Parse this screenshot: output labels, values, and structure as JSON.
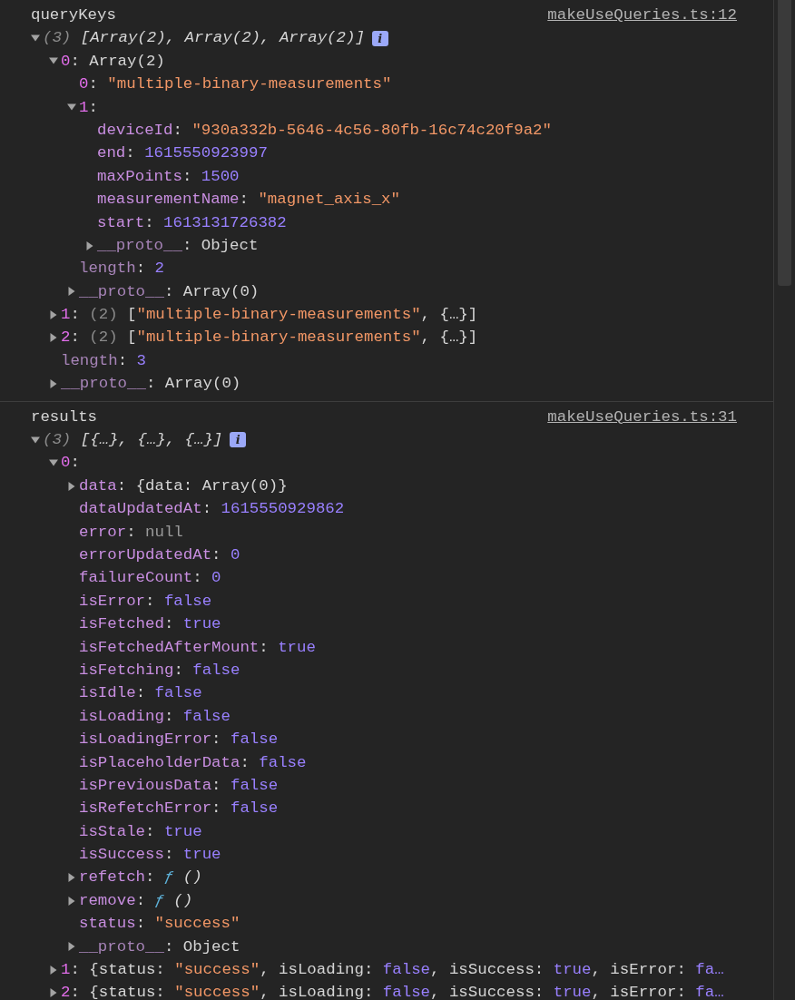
{
  "messages": [
    {
      "label": "queryKeys",
      "source_link": "makeUseQueries.ts:12",
      "tree": [
        {
          "expanded": true,
          "tokens": [
            {
              "kind": "summary_count",
              "text": "(3) "
            },
            {
              "kind": "summary",
              "text": "[Array(2), Array(2), Array(2)]"
            },
            {
              "kind": "info",
              "text": "i"
            }
          ],
          "children": [
            {
              "expanded": true,
              "tokens": [
                {
                  "kind": "index",
                  "text": "0"
                },
                {
                  "kind": "punct",
                  "text": ": "
                },
                {
                  "kind": "plain",
                  "text": "Array(2)"
                }
              ],
              "children": [
                {
                  "tokens": [
                    {
                      "kind": "index",
                      "text": "0"
                    },
                    {
                      "kind": "punct",
                      "text": ": "
                    },
                    {
                      "kind": "string",
                      "text": "\"multiple-binary-measurements\""
                    }
                  ]
                },
                {
                  "expanded": true,
                  "tokens": [
                    {
                      "kind": "index",
                      "text": "1"
                    },
                    {
                      "kind": "punct",
                      "text": ":"
                    }
                  ],
                  "children": [
                    {
                      "tokens": [
                        {
                          "kind": "key",
                          "text": "deviceId"
                        },
                        {
                          "kind": "punct",
                          "text": ": "
                        },
                        {
                          "kind": "string",
                          "text": "\"930a332b-5646-4c56-80fb-16c74c20f9a2\""
                        }
                      ]
                    },
                    {
                      "tokens": [
                        {
                          "kind": "key",
                          "text": "end"
                        },
                        {
                          "kind": "punct",
                          "text": ": "
                        },
                        {
                          "kind": "number",
                          "text": "1615550923997"
                        }
                      ]
                    },
                    {
                      "tokens": [
                        {
                          "kind": "key",
                          "text": "maxPoints"
                        },
                        {
                          "kind": "punct",
                          "text": ": "
                        },
                        {
                          "kind": "number",
                          "text": "1500"
                        }
                      ]
                    },
                    {
                      "tokens": [
                        {
                          "kind": "key",
                          "text": "measurementName"
                        },
                        {
                          "kind": "punct",
                          "text": ": "
                        },
                        {
                          "kind": "string",
                          "text": "\"magnet_axis_x\""
                        }
                      ]
                    },
                    {
                      "tokens": [
                        {
                          "kind": "key",
                          "text": "start"
                        },
                        {
                          "kind": "punct",
                          "text": ": "
                        },
                        {
                          "kind": "number",
                          "text": "1613131726382"
                        }
                      ]
                    },
                    {
                      "expanded": false,
                      "tokens": [
                        {
                          "kind": "dimkey",
                          "text": "__proto__"
                        },
                        {
                          "kind": "punct",
                          "text": ": "
                        },
                        {
                          "kind": "plain",
                          "text": "Object"
                        }
                      ]
                    }
                  ]
                },
                {
                  "tokens": [
                    {
                      "kind": "dimkey",
                      "text": "length"
                    },
                    {
                      "kind": "punct",
                      "text": ": "
                    },
                    {
                      "kind": "number",
                      "text": "2"
                    }
                  ]
                },
                {
                  "expanded": false,
                  "tokens": [
                    {
                      "kind": "dimkey",
                      "text": "__proto__"
                    },
                    {
                      "kind": "punct",
                      "text": ": "
                    },
                    {
                      "kind": "plain",
                      "text": "Array(0)"
                    }
                  ]
                }
              ]
            },
            {
              "expanded": false,
              "tokens": [
                {
                  "kind": "index",
                  "text": "1"
                },
                {
                  "kind": "punct",
                  "text": ": "
                },
                {
                  "kind": "count",
                  "text": "(2) "
                },
                {
                  "kind": "plain",
                  "text": "["
                },
                {
                  "kind": "string",
                  "text": "\"multiple-binary-measurements\""
                },
                {
                  "kind": "plain",
                  "text": ", {…}]"
                }
              ]
            },
            {
              "expanded": false,
              "tokens": [
                {
                  "kind": "index",
                  "text": "2"
                },
                {
                  "kind": "punct",
                  "text": ": "
                },
                {
                  "kind": "count",
                  "text": "(2) "
                },
                {
                  "kind": "plain",
                  "text": "["
                },
                {
                  "kind": "string",
                  "text": "\"multiple-binary-measurements\""
                },
                {
                  "kind": "plain",
                  "text": ", {…}]"
                }
              ]
            },
            {
              "tokens": [
                {
                  "kind": "dimkey",
                  "text": "length"
                },
                {
                  "kind": "punct",
                  "text": ": "
                },
                {
                  "kind": "number",
                  "text": "3"
                }
              ]
            },
            {
              "expanded": false,
              "tokens": [
                {
                  "kind": "dimkey",
                  "text": "__proto__"
                },
                {
                  "kind": "punct",
                  "text": ": "
                },
                {
                  "kind": "plain",
                  "text": "Array(0)"
                }
              ]
            }
          ]
        }
      ]
    },
    {
      "label": "results",
      "source_link": "makeUseQueries.ts:31",
      "tree": [
        {
          "expanded": true,
          "tokens": [
            {
              "kind": "summary_count",
              "text": "(3) "
            },
            {
              "kind": "summary",
              "text": "[{…}, {…}, {…}]"
            },
            {
              "kind": "info",
              "text": "i"
            }
          ],
          "children": [
            {
              "expanded": true,
              "tokens": [
                {
                  "kind": "index",
                  "text": "0"
                },
                {
                  "kind": "punct",
                  "text": ":"
                }
              ],
              "children": [
                {
                  "expanded": false,
                  "tokens": [
                    {
                      "kind": "key",
                      "text": "data"
                    },
                    {
                      "kind": "punct",
                      "text": ": "
                    },
                    {
                      "kind": "plain",
                      "text": "{data: Array(0)}"
                    }
                  ]
                },
                {
                  "tokens": [
                    {
                      "kind": "key",
                      "text": "dataUpdatedAt"
                    },
                    {
                      "kind": "punct",
                      "text": ": "
                    },
                    {
                      "kind": "number",
                      "text": "1615550929862"
                    }
                  ]
                },
                {
                  "tokens": [
                    {
                      "kind": "key",
                      "text": "error"
                    },
                    {
                      "kind": "punct",
                      "text": ": "
                    },
                    {
                      "kind": "null",
                      "text": "null"
                    }
                  ]
                },
                {
                  "tokens": [
                    {
                      "kind": "key",
                      "text": "errorUpdatedAt"
                    },
                    {
                      "kind": "punct",
                      "text": ": "
                    },
                    {
                      "kind": "number",
                      "text": "0"
                    }
                  ]
                },
                {
                  "tokens": [
                    {
                      "kind": "key",
                      "text": "failureCount"
                    },
                    {
                      "kind": "punct",
                      "text": ": "
                    },
                    {
                      "kind": "number",
                      "text": "0"
                    }
                  ]
                },
                {
                  "tokens": [
                    {
                      "kind": "key",
                      "text": "isError"
                    },
                    {
                      "kind": "punct",
                      "text": ": "
                    },
                    {
                      "kind": "number",
                      "text": "false"
                    }
                  ]
                },
                {
                  "tokens": [
                    {
                      "kind": "key",
                      "text": "isFetched"
                    },
                    {
                      "kind": "punct",
                      "text": ": "
                    },
                    {
                      "kind": "number",
                      "text": "true"
                    }
                  ]
                },
                {
                  "tokens": [
                    {
                      "kind": "key",
                      "text": "isFetchedAfterMount"
                    },
                    {
                      "kind": "punct",
                      "text": ": "
                    },
                    {
                      "kind": "number",
                      "text": "true"
                    }
                  ]
                },
                {
                  "tokens": [
                    {
                      "kind": "key",
                      "text": "isFetching"
                    },
                    {
                      "kind": "punct",
                      "text": ": "
                    },
                    {
                      "kind": "number",
                      "text": "false"
                    }
                  ]
                },
                {
                  "tokens": [
                    {
                      "kind": "key",
                      "text": "isIdle"
                    },
                    {
                      "kind": "punct",
                      "text": ": "
                    },
                    {
                      "kind": "number",
                      "text": "false"
                    }
                  ]
                },
                {
                  "tokens": [
                    {
                      "kind": "key",
                      "text": "isLoading"
                    },
                    {
                      "kind": "punct",
                      "text": ": "
                    },
                    {
                      "kind": "number",
                      "text": "false"
                    }
                  ]
                },
                {
                  "tokens": [
                    {
                      "kind": "key",
                      "text": "isLoadingError"
                    },
                    {
                      "kind": "punct",
                      "text": ": "
                    },
                    {
                      "kind": "number",
                      "text": "false"
                    }
                  ]
                },
                {
                  "tokens": [
                    {
                      "kind": "key",
                      "text": "isPlaceholderData"
                    },
                    {
                      "kind": "punct",
                      "text": ": "
                    },
                    {
                      "kind": "number",
                      "text": "false"
                    }
                  ]
                },
                {
                  "tokens": [
                    {
                      "kind": "key",
                      "text": "isPreviousData"
                    },
                    {
                      "kind": "punct",
                      "text": ": "
                    },
                    {
                      "kind": "number",
                      "text": "false"
                    }
                  ]
                },
                {
                  "tokens": [
                    {
                      "kind": "key",
                      "text": "isRefetchError"
                    },
                    {
                      "kind": "punct",
                      "text": ": "
                    },
                    {
                      "kind": "number",
                      "text": "false"
                    }
                  ]
                },
                {
                  "tokens": [
                    {
                      "kind": "key",
                      "text": "isStale"
                    },
                    {
                      "kind": "punct",
                      "text": ": "
                    },
                    {
                      "kind": "number",
                      "text": "true"
                    }
                  ]
                },
                {
                  "tokens": [
                    {
                      "kind": "key",
                      "text": "isSuccess"
                    },
                    {
                      "kind": "punct",
                      "text": ": "
                    },
                    {
                      "kind": "number",
                      "text": "true"
                    }
                  ]
                },
                {
                  "expanded": false,
                  "tokens": [
                    {
                      "kind": "key",
                      "text": "refetch"
                    },
                    {
                      "kind": "punct",
                      "text": ": "
                    },
                    {
                      "kind": "func",
                      "text": "ƒ"
                    },
                    {
                      "kind": "func_sig",
                      "text": " ()"
                    }
                  ]
                },
                {
                  "expanded": false,
                  "tokens": [
                    {
                      "kind": "key",
                      "text": "remove"
                    },
                    {
                      "kind": "punct",
                      "text": ": "
                    },
                    {
                      "kind": "func",
                      "text": "ƒ"
                    },
                    {
                      "kind": "func_sig",
                      "text": " ()"
                    }
                  ]
                },
                {
                  "tokens": [
                    {
                      "kind": "key",
                      "text": "status"
                    },
                    {
                      "kind": "punct",
                      "text": ": "
                    },
                    {
                      "kind": "string",
                      "text": "\"success\""
                    }
                  ]
                },
                {
                  "expanded": false,
                  "tokens": [
                    {
                      "kind": "dimkey",
                      "text": "__proto__"
                    },
                    {
                      "kind": "punct",
                      "text": ": "
                    },
                    {
                      "kind": "plain",
                      "text": "Object"
                    }
                  ]
                }
              ]
            },
            {
              "expanded": false,
              "tokens": [
                {
                  "kind": "index",
                  "text": "1"
                },
                {
                  "kind": "punct",
                  "text": ": "
                },
                {
                  "kind": "plain",
                  "text": "{status: "
                },
                {
                  "kind": "string",
                  "text": "\"success\""
                },
                {
                  "kind": "plain",
                  "text": ", isLoading: "
                },
                {
                  "kind": "number",
                  "text": "false"
                },
                {
                  "kind": "plain",
                  "text": ", isSuccess: "
                },
                {
                  "kind": "number",
                  "text": "true"
                },
                {
                  "kind": "plain",
                  "text": ", isError: "
                },
                {
                  "kind": "number",
                  "text": "fa…"
                }
              ]
            },
            {
              "expanded": false,
              "tokens": [
                {
                  "kind": "index",
                  "text": "2"
                },
                {
                  "kind": "punct",
                  "text": ": "
                },
                {
                  "kind": "plain",
                  "text": "{status: "
                },
                {
                  "kind": "string",
                  "text": "\"success\""
                },
                {
                  "kind": "plain",
                  "text": ", isLoading: "
                },
                {
                  "kind": "number",
                  "text": "false"
                },
                {
                  "kind": "plain",
                  "text": ", isSuccess: "
                },
                {
                  "kind": "number",
                  "text": "true"
                },
                {
                  "kind": "plain",
                  "text": ", isError: "
                },
                {
                  "kind": "number",
                  "text": "fa…"
                }
              ]
            }
          ]
        }
      ]
    }
  ]
}
